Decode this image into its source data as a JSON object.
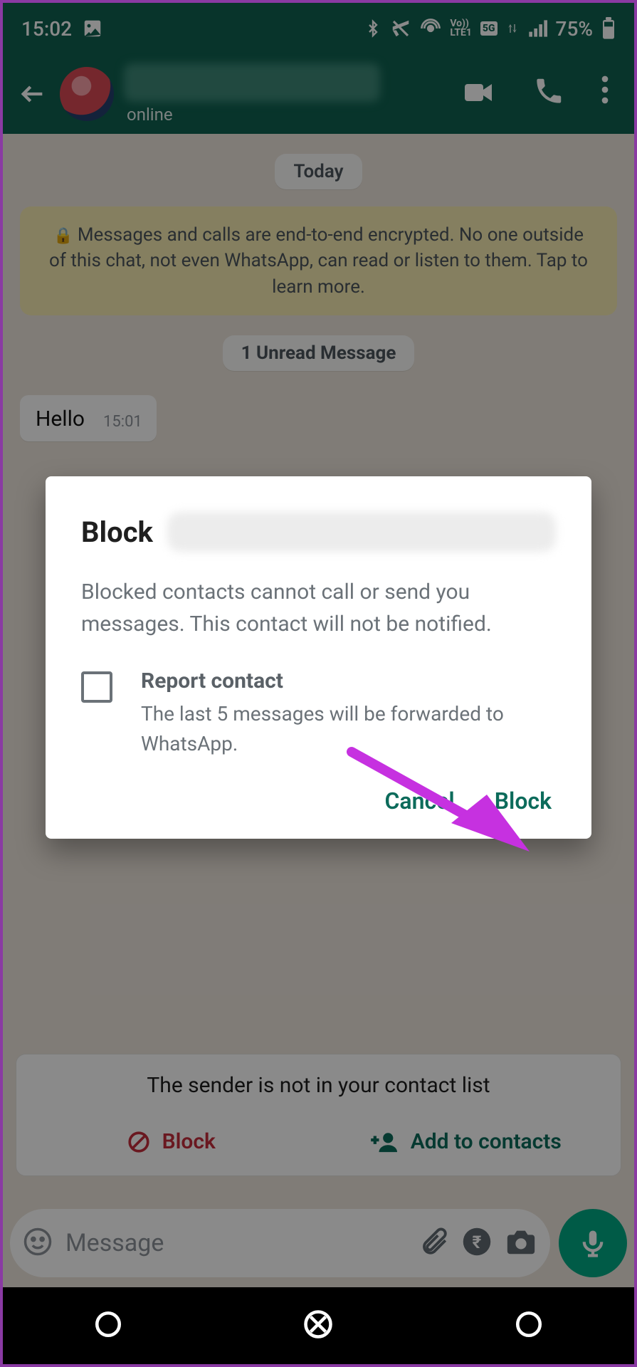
{
  "statusbar": {
    "time": "15:02",
    "battery": "75%"
  },
  "header": {
    "status_text": "online"
  },
  "chat": {
    "date_chip": "Today",
    "encryption_notice": "Messages and calls are end-to-end encrypted. No one outside of this chat, not even WhatsApp, can read or listen to them. Tap to learn more.",
    "unread_chip": "1 Unread Message",
    "message_text": "Hello",
    "message_time": "15:01"
  },
  "unknown_card": {
    "title": "The sender is not in your contact list",
    "block_label": "Block",
    "add_label": "Add to contacts"
  },
  "input": {
    "placeholder": "Message"
  },
  "dialog": {
    "title": "Block",
    "description": "Blocked contacts cannot call or send you messages. This contact will not be notified.",
    "report_title": "Report contact",
    "report_desc": "The last 5 messages will be forwarded to WhatsApp.",
    "cancel": "Cancel",
    "block": "Block"
  }
}
